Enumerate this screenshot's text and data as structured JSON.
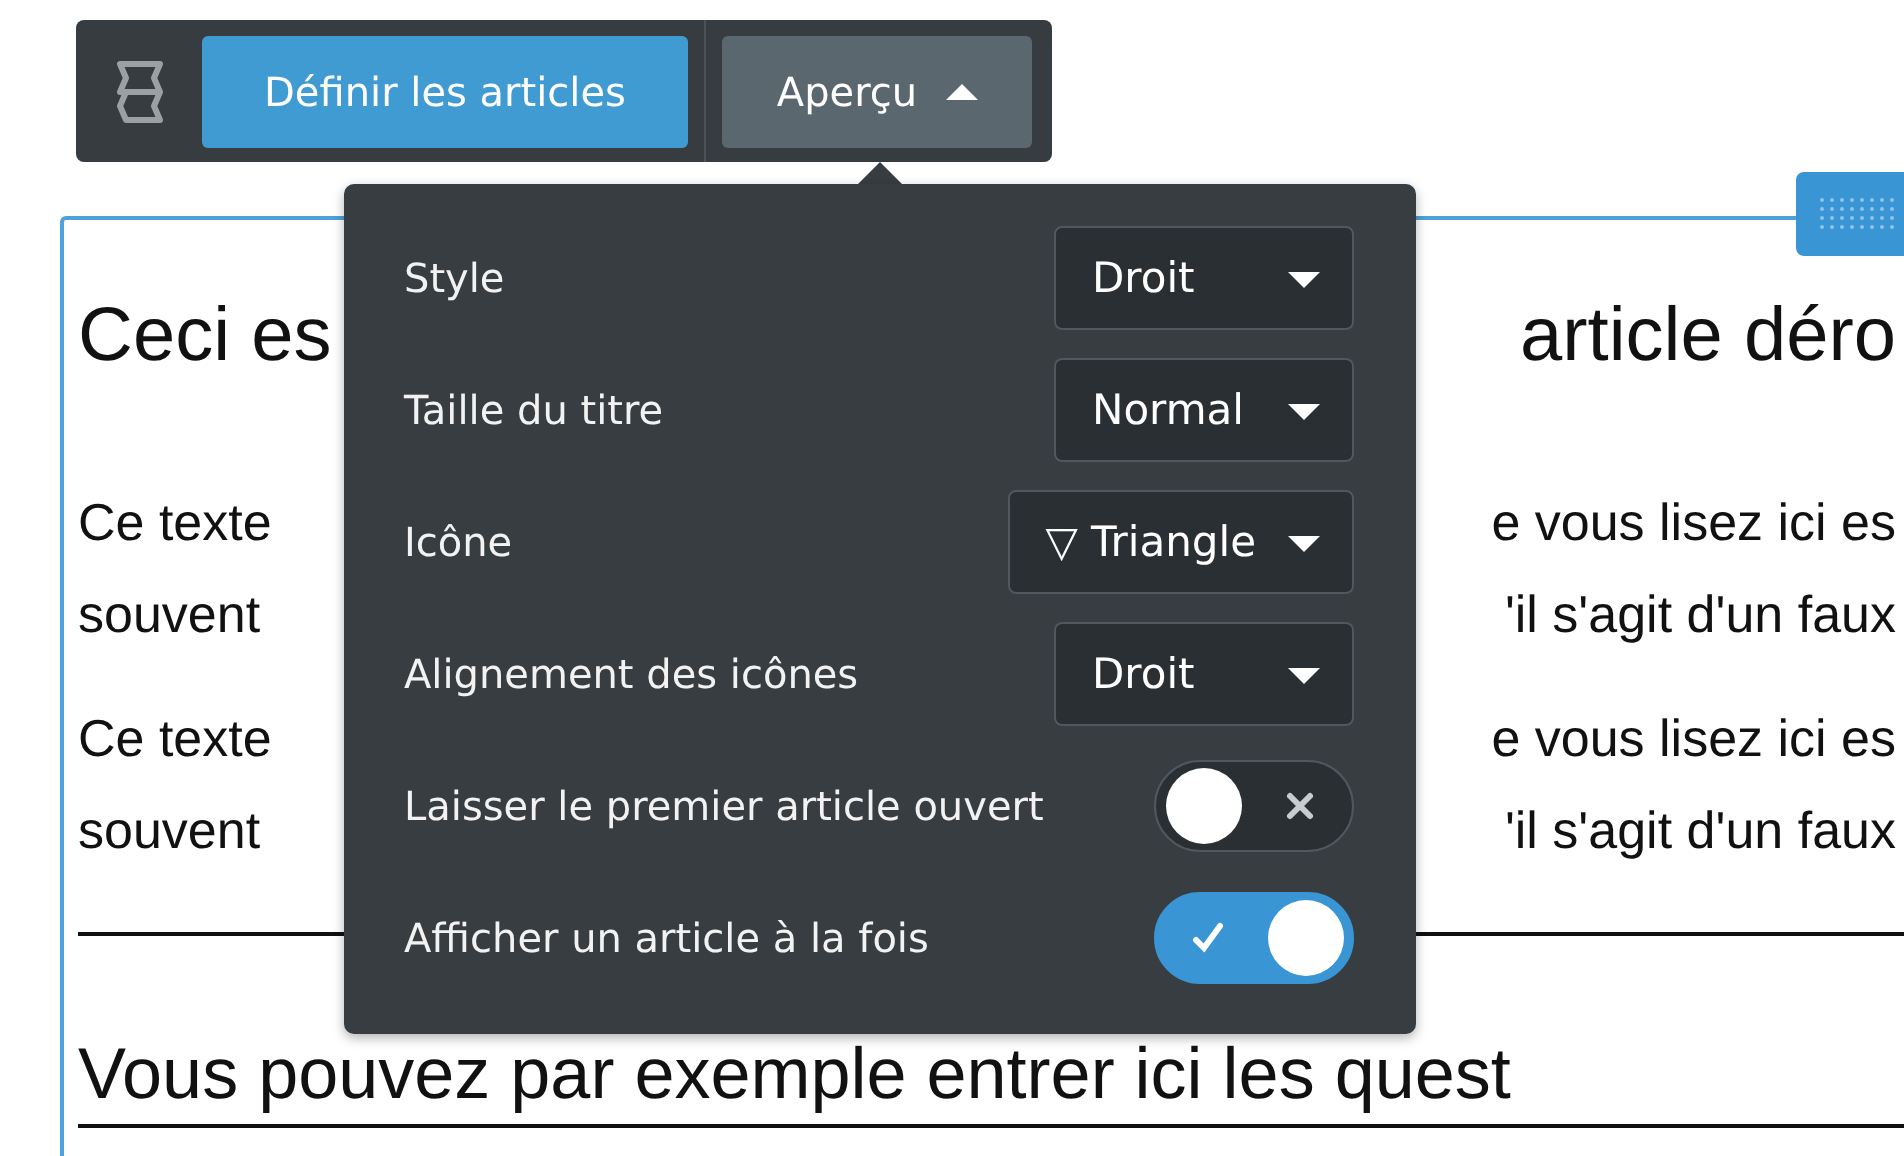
{
  "toolbar": {
    "buttons": [
      {
        "kind": "primary",
        "label": "Définir les articles"
      },
      {
        "kind": "dropdown",
        "label": "Aperçu",
        "expanded": true
      }
    ]
  },
  "popover": {
    "settings": [
      {
        "kind": "select",
        "label": "Style",
        "value": "Droit"
      },
      {
        "kind": "select",
        "label": "Taille du titre",
        "value": "Normal"
      },
      {
        "kind": "select",
        "label": "Icône",
        "value": "▽ Triangle"
      },
      {
        "kind": "select",
        "label": "Alignement des icônes",
        "value": "Droit"
      },
      {
        "kind": "toggle",
        "label": "Laisser le premier article ouvert",
        "on": false
      },
      {
        "kind": "toggle",
        "label": "Afficher un article à la fois",
        "on": true
      }
    ]
  },
  "document": {
    "blocks": [
      {
        "kind": "heading",
        "left": "Ceci es",
        "right": "article déro"
      },
      {
        "kind": "paragraph",
        "lines": [
          {
            "left": "Ce texte",
            "right": "e vous lisez ici es"
          },
          {
            "left": "souvent",
            "right": "'il s'agit d'un faux"
          }
        ]
      },
      {
        "kind": "paragraph",
        "lines": [
          {
            "left": "Ce texte",
            "right": "e vous lisez ici es"
          },
          {
            "left": "souvent",
            "right": "'il s'agit d'un faux"
          }
        ]
      },
      {
        "kind": "rule"
      },
      {
        "kind": "heading",
        "text": "Vous pouvez par exemple entrer ici les quest"
      },
      {
        "kind": "rule"
      }
    ]
  }
}
